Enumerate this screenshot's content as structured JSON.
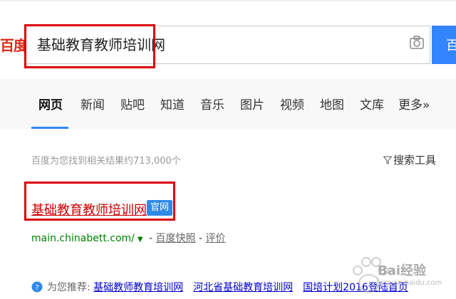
{
  "header": {
    "logo_text": "百度",
    "search_value": "基础教育教师培训网",
    "search_button_label": "百"
  },
  "tabs": [
    {
      "label": "网页",
      "active": true
    },
    {
      "label": "新闻"
    },
    {
      "label": "贴吧"
    },
    {
      "label": "知道"
    },
    {
      "label": "音乐"
    },
    {
      "label": "图片"
    },
    {
      "label": "视频"
    },
    {
      "label": "地图"
    },
    {
      "label": "文库"
    },
    {
      "label": "更多»"
    }
  ],
  "results_meta": {
    "count_text": "百度为您找到相关结果约713,000个",
    "tools_label": "搜索工具"
  },
  "first_result": {
    "title": "基础教育教师培训网",
    "badge": "官网",
    "url": "main.chinabett.com/",
    "caret": "▼",
    "separator1": " - ",
    "snapshot_label": "百度快照",
    "separator2": " - ",
    "review_label": "评价"
  },
  "recommendations": {
    "prefix": "为您推荐:",
    "links": [
      "基础教师教育培训网",
      "河北省基础教育培训网",
      "国培计划2016登陆首页"
    ]
  },
  "watermark": {
    "text": "Bai经验",
    "sub": "jingyan.baidu.com"
  },
  "colors": {
    "brand_red": "#de2a18",
    "highlight_red": "#d9000b",
    "accent_blue": "#3385ff",
    "url_green": "#008000",
    "link_blue": "#0000cc"
  }
}
